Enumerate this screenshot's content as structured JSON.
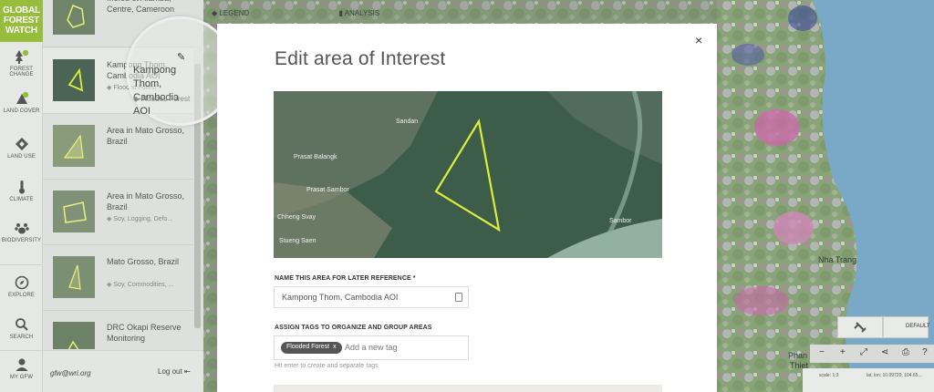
{
  "app": {
    "logo_line1": "GLOBAL",
    "logo_line2": "FOREST",
    "logo_line3": "WATCH"
  },
  "nav": {
    "items": [
      {
        "label": "FOREST CHANGE",
        "icon": "forest-change-icon"
      },
      {
        "label": "LAND COVER",
        "icon": "land-cover-icon"
      },
      {
        "label": "LAND USE",
        "icon": "land-use-icon"
      },
      {
        "label": "CLIMATE",
        "icon": "climate-icon"
      },
      {
        "label": "BIODIVERSITY",
        "icon": "biodiversity-icon"
      },
      {
        "label": "EXPLORE",
        "icon": "compass-icon"
      },
      {
        "label": "SEARCH",
        "icon": "search-icon"
      },
      {
        "label": "MY GFW",
        "icon": "user-icon"
      }
    ]
  },
  "areas": {
    "items": [
      {
        "name": "Mefou et Afamba, Centre, Cameroon",
        "tags": ""
      },
      {
        "name": "Kampong Thom, Cambodia AOI",
        "tags": "Flooded Forest"
      },
      {
        "name": "Area in Mato Grosso, Brazil",
        "tags": ""
      },
      {
        "name": "Area in Mato Grosso, Brazil",
        "tags": "Soy, Logging, Defo..."
      },
      {
        "name": "Mato Grosso, Brazil",
        "tags": "Soy, Commodities, ..."
      },
      {
        "name": "DRC Okapi Reserve Monitoring",
        "tags": ""
      }
    ],
    "user_email": "gfw@wri.org",
    "logout_label": "Log out"
  },
  "magnifier": {
    "title": "Kampong Thom, Cambodia AOI",
    "tag": "Flooded Forest"
  },
  "toolbar_top": {
    "legend": "LEGEND",
    "analysis": "ANALYSIS"
  },
  "modal": {
    "title": "Edit area of Interest",
    "close": "×",
    "name_label": "NAME THIS AREA FOR LATER REFERENCE *",
    "name_value": "Kampong Thom, Cambodia AOI",
    "tags_label": "ASSIGN TAGS TO ORGANIZE AND GROUP AREAS",
    "chip_label": "Flooded Forest",
    "chip_remove": "x",
    "tags_placeholder": "Add a new tag",
    "hint": "Hit enter to create and separate tags",
    "map_places": [
      "Sandan",
      "Prasat Balangk",
      "Prasat Sambor",
      "Chheng Svay",
      "Stueng Saen",
      "Sambor"
    ]
  },
  "map_controls": {
    "basemap_label": "DEFAULT",
    "tools": [
      "−",
      "+",
      "⤢",
      "⋖",
      "⎙",
      "?"
    ],
    "scale": "scale: 1:3",
    "coords": "lat, lon: 10.09720, 104.65..."
  },
  "map_places": [
    "Phan",
    "Nha Trang",
    "Thiet"
  ],
  "colors": {
    "brand_green": "#97bd3d",
    "aoi_outline": "#d8f03a",
    "loss_pink": "#d36aa6",
    "water": "#7aa9c7"
  }
}
